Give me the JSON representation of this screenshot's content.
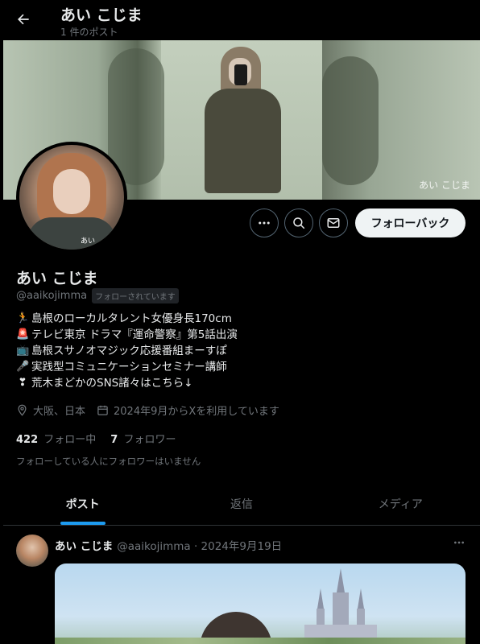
{
  "header": {
    "back_icon": "arrow-left-icon",
    "title": "あい こじま",
    "post_count": "1 件のポスト"
  },
  "banner": {
    "watermark": "あい こじま"
  },
  "avatar": {
    "label": "あい"
  },
  "actions": {
    "more_icon": "more-horizontal-icon",
    "search_icon": "search-icon",
    "message_icon": "envelope-icon",
    "follow_back_label": "フォローバック"
  },
  "profile": {
    "display_name": "あい こじま",
    "handle": "@aaikojimma",
    "follows_you": "フォローされています",
    "bio": [
      {
        "emoji": "🏃",
        "text": "島根のローカルタレント女優身長170cm"
      },
      {
        "emoji": "🚨",
        "text": "テレビ東京 ドラマ『運命警察』第5話出演"
      },
      {
        "emoji": "📺",
        "text": "島根スサノオマジック応援番組まーすぽ"
      },
      {
        "emoji": "🎤",
        "text": "実践型コミュニケーションセミナー講師"
      },
      {
        "emoji": "❣",
        "text": "荒木まどかのSNS諸々はこちら↓"
      }
    ],
    "location": "大阪、日本",
    "joined": "2024年9月からXを利用しています",
    "following_count": "422",
    "following_label": "フォロー中",
    "followers_count": "7",
    "followers_label": "フォロワー",
    "no_mutual_followers": "フォローしている人にフォロワーはいません"
  },
  "tabs": [
    {
      "label": "ポスト",
      "active": true
    },
    {
      "label": "返信",
      "active": false
    },
    {
      "label": "メディア",
      "active": false
    }
  ],
  "post": {
    "author_name": "あい こじま",
    "meta": "@aaikojimma · 2024年9月19日",
    "more_icon": "more-horizontal-icon"
  },
  "colors": {
    "background": "#000000",
    "text_primary": "#e7e9ea",
    "text_secondary": "#71767b",
    "accent": "#1d9bf0",
    "follow_button_bg": "#eff3f4"
  }
}
